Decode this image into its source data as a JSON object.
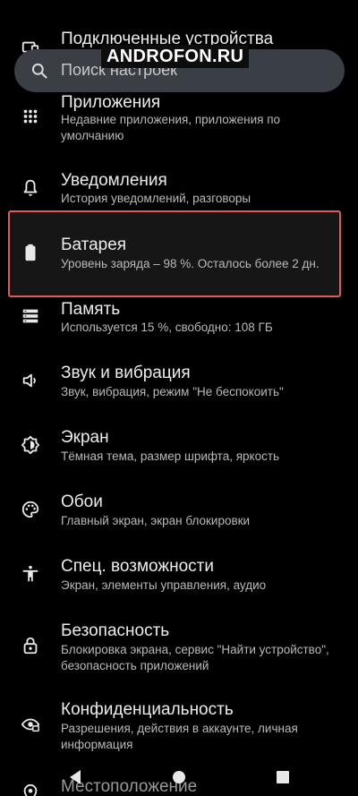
{
  "search": {
    "placeholder": "Поиск настроек",
    "icon": "search-icon"
  },
  "watermark": "ANDROFON.RU",
  "items": [
    {
      "title": "Подключенные устройства",
      "subtitle": "",
      "icon": "devices-icon"
    },
    {
      "title": "Приложения",
      "subtitle": "Недавние приложения, приложения по умолчанию",
      "icon": "apps-grid-icon"
    },
    {
      "title": "Уведомления",
      "subtitle": "История уведомлений, разговоры",
      "icon": "bell-icon"
    },
    {
      "title": "Батарея",
      "subtitle": "Уровень заряда – 98 %. Осталось более 2 дн.",
      "icon": "battery-icon"
    },
    {
      "title": "Память",
      "subtitle": "Используется 15 %, свободно: 108 ГБ",
      "icon": "storage-icon"
    },
    {
      "title": "Звук и вибрация",
      "subtitle": "Звук, вибрация, режим \"Не беспокоить\"",
      "icon": "volume-icon"
    },
    {
      "title": "Экран",
      "subtitle": "Тёмная тема, размер шрифта, яркость",
      "icon": "display-brightness-icon"
    },
    {
      "title": "Обои",
      "subtitle": "Главный экран, экран блокировки",
      "icon": "palette-icon"
    },
    {
      "title": "Спец. возможности",
      "subtitle": "Экран, элементы управления, аудио",
      "icon": "accessibility-icon"
    },
    {
      "title": "Безопасность",
      "subtitle": "Блокировка экрана, сервис \"Найти устройство\", безопасность приложений",
      "icon": "lock-icon"
    },
    {
      "title": "Конфиденциальность",
      "subtitle": "Разрешения, действия в аккаунте, личная информация",
      "icon": "privacy-eye-icon"
    },
    {
      "title": "Местоположение",
      "subtitle": "",
      "icon": "location-icon"
    }
  ],
  "highlight_color": "#e05a5a",
  "navbar": {
    "back": "back-icon",
    "home": "home-icon",
    "recents": "recents-icon"
  }
}
